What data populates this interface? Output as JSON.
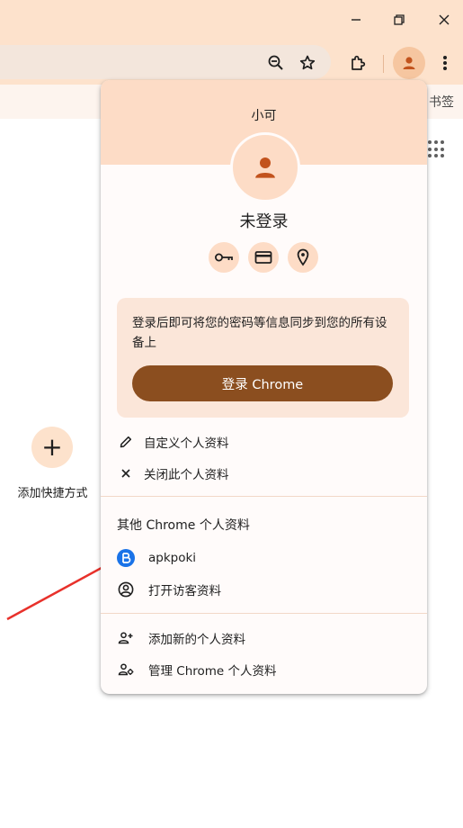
{
  "window": {
    "minimize_icon": "minimize-icon",
    "restore_icon": "restore-icon",
    "close_icon": "close-icon"
  },
  "toolbar": {
    "icons": [
      "zoom-out-icon",
      "star-icon",
      "extensions-icon",
      "avatar-icon",
      "more-vert-icon"
    ]
  },
  "bookmarks_bar": {
    "partial_label": "书签"
  },
  "ntp": {
    "shortcut_add_symbol": "+",
    "shortcut_add_label": "添加快捷方式"
  },
  "profile_menu": {
    "profile_name": "小可",
    "signin_state": "未登录",
    "quick_actions": [
      "passwords-key-icon",
      "payment-card-icon",
      "addresses-location-icon"
    ],
    "promo_text": "登录后即可将您的密码等信息同步到您的所有设备上",
    "signin_button": "登录 Chrome",
    "customize_profile": "自定义个人资料",
    "close_profile": "关闭此个人资料",
    "other_profiles_title": "其他 Chrome 个人资料",
    "other_profiles": [
      {
        "name": "apkpoki"
      }
    ],
    "guest_profile": "打开访客资料",
    "add_profile": "添加新的个人资料",
    "manage_profiles": "管理 Chrome 个人资料"
  },
  "colors": {
    "frame": "#fde2cc",
    "accent_button": "#8b4e1f",
    "avatar_fg": "#c2531d",
    "annotation_arrow": "#e8312b"
  }
}
